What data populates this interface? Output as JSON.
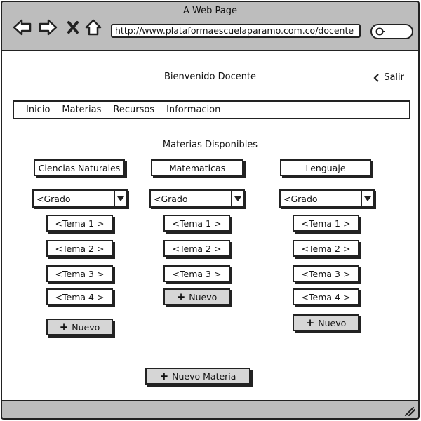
{
  "window": {
    "title": "A Web Page"
  },
  "browser": {
    "url": "http://www.plataformaescuelaparamo.com.co/docente",
    "icons": [
      "back-arrow-icon",
      "forward-arrow-icon",
      "stop-icon",
      "home-icon",
      "search-icon"
    ]
  },
  "header": {
    "welcome": "Bienvenido Docente",
    "logout": "Salir"
  },
  "menu": {
    "items": [
      "Inicio",
      "Materias",
      "Recursos",
      "Informacion"
    ]
  },
  "section_title": "Materias Disponibles",
  "subjects": [
    {
      "name": "Ciencias Naturales",
      "grade_select": "<Grado",
      "topics": [
        "<Tema 1 >",
        "<Tema 2 >",
        "<Tema 3 >",
        "<Tema 4 >"
      ],
      "new_label": "Nuevo"
    },
    {
      "name": "Matematicas",
      "grade_select": "<Grado",
      "topics": [
        "<Tema 1 >",
        "<Tema 2 >",
        "<Tema 3 >"
      ],
      "new_label": "Nuevo"
    },
    {
      "name": "Lenguaje",
      "grade_select": "<Grado",
      "topics": [
        "<Tema 1 >",
        "<Tema 2 >",
        "<Tema 3 >",
        "<Tema 4 >"
      ],
      "new_label": "Nuevo"
    }
  ],
  "new_subject_label": "Nuevo Materia",
  "plus_symbol": "+"
}
